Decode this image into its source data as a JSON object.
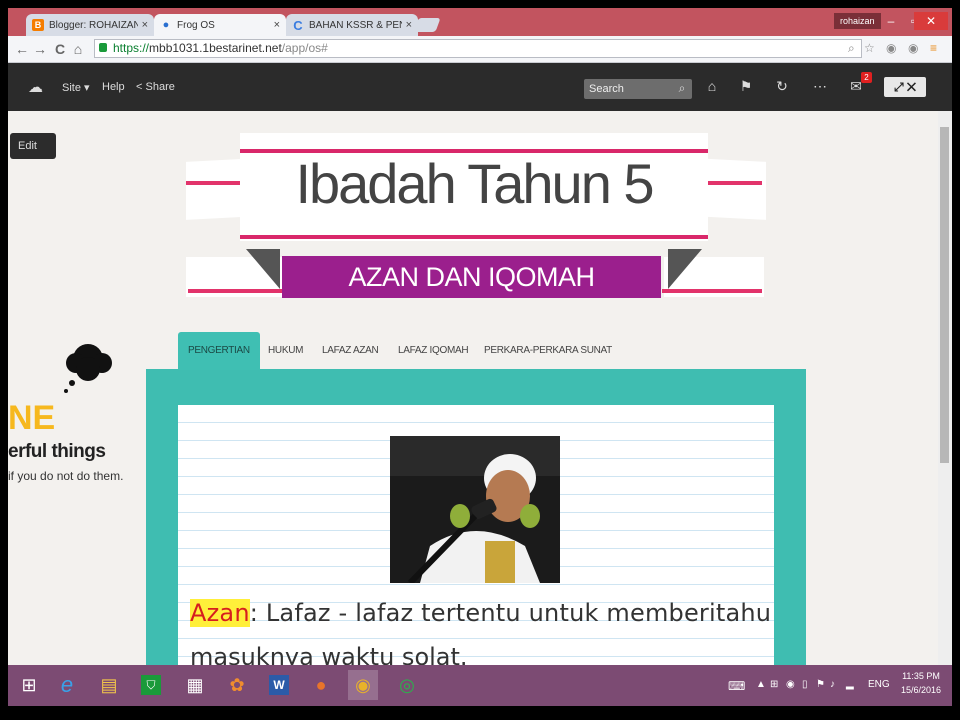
{
  "browser": {
    "tabs": [
      {
        "label": "Blogger: ROHAIZAN BINTI",
        "icon": "blogger-icon",
        "color": "#f57d00"
      },
      {
        "label": "Frog OS",
        "icon": "frog-icon",
        "color": "#2a6fd0"
      },
      {
        "label": "BAHAN KSSR & PENDJSU",
        "icon": "c-icon",
        "color": "#3b7de0"
      }
    ],
    "user": "rohaizan",
    "url_secure": "https://",
    "url_host": "mbb1031.1bestarinet.net",
    "url_path": "/app/os#"
  },
  "frogbar": {
    "site": "Site",
    "help": "Help",
    "share": "Share",
    "search_placeholder": "Search",
    "notification_count": "2"
  },
  "page": {
    "edit": "Edit",
    "title": "Ibadah Tahun 5",
    "subtitle": "AZAN DAN IQOMAH",
    "side_ne": "NE",
    "side_line1": "erful things",
    "side_line2": "if you do not do them.",
    "tabs": [
      "PENGERTIAN",
      "HUKUM",
      "LAFAZ AZAN",
      "LAFAZ IQOMAH",
      "PERKARA-PERKARA SUNAT"
    ],
    "term": "Azan",
    "definition_1": ": Lafaz - lafaz tertentu untuk memberitahu",
    "definition_2": "masuknya waktu solat."
  },
  "taskbar": {
    "lang": "ENG",
    "time": "11:35 PM",
    "date": "15/6/2016"
  },
  "colors": {
    "ribbon_pink": "#e2336b",
    "subtitle_purple": "#9b1f8d",
    "teal": "#3fbdb1",
    "tabstrip": "#c2545f",
    "taskbar": "#7c4b73"
  }
}
